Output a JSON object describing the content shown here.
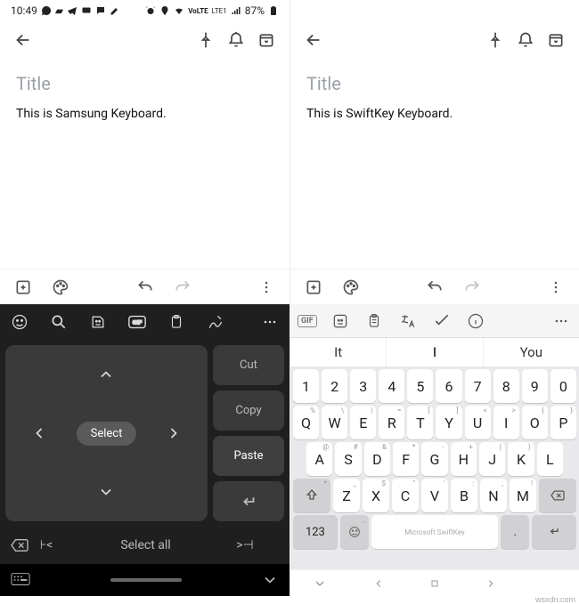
{
  "left": {
    "status": {
      "time": "10:49",
      "battery": "87%",
      "network": "LTE1"
    },
    "title_placeholder": "Title",
    "body": "This is Samsung Keyboard.",
    "keyboard": {
      "select": "Select",
      "cut": "Cut",
      "copy": "Copy",
      "paste": "Paste",
      "select_all": "Select all"
    }
  },
  "right": {
    "title_placeholder": "Title",
    "body": "This is SwiftKey Keyboard.",
    "gif_label": "GIF",
    "predictions": {
      "left": "It",
      "center": "I",
      "right": "You"
    },
    "numbers": [
      "1",
      "2",
      "3",
      "4",
      "5",
      "6",
      "7",
      "8",
      "9",
      "0"
    ],
    "row_q": [
      "Q",
      "W",
      "E",
      "R",
      "T",
      "Y",
      "U",
      "I",
      "O",
      "P"
    ],
    "row_q_hints": [
      "%",
      "\\",
      "|",
      "=",
      "[",
      "]",
      "<",
      ">",
      "{",
      "}"
    ],
    "row_a": [
      "A",
      "S",
      "D",
      "F",
      "G",
      "H",
      "J",
      "K",
      "L"
    ],
    "row_a_hints": [
      "@",
      "#",
      "&",
      "*",
      "-",
      "+",
      "(",
      ")",
      ""
    ],
    "row_z": [
      "Z",
      "X",
      "C",
      "V",
      "B",
      "N",
      "M"
    ],
    "row_z_hints": [
      "_",
      "$",
      "\"",
      "'",
      ":",
      ";",
      "!"
    ],
    "shift_hint": "*",
    "fn": {
      "sym": "123",
      "comma": ",",
      "period": ".",
      "space": "Microsoft SwiftKey"
    }
  },
  "watermark": "wsxdn.com"
}
